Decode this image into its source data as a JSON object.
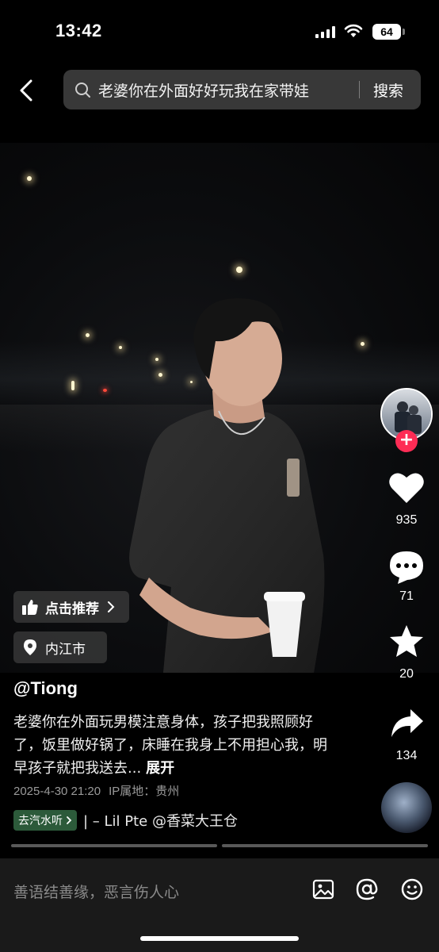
{
  "status": {
    "time": "13:42",
    "battery": "64"
  },
  "search": {
    "query": "老婆你在外面好好玩我在家带娃",
    "button_label": "搜索"
  },
  "badges": {
    "recommend_label": "点击推荐",
    "location_label": "内江市"
  },
  "actions": {
    "likes": "935",
    "comments": "71",
    "favorites": "20",
    "shares": "134",
    "follow_symbol": "+"
  },
  "post": {
    "author": "@Tiong",
    "description": "老婆你在外面玩男模注意身体，孩子把我照顾好了，饭里做好锅了，床睡在我身上不用担心我，明早孩子就把我送去...",
    "expand_label": "展开",
    "date": "2025-4-30 21:20",
    "ip_location": "IP属地：贵州"
  },
  "music": {
    "tag_label": "去汽水听",
    "track_text": "| – Lil Pte   @香菜大王仓"
  },
  "comment_bar": {
    "placeholder": "善语结善缘，恶言伤人心"
  },
  "colors": {
    "background": "#000000",
    "follow_accent": "#fe2c55",
    "music_tag": "#2c5a3a"
  }
}
